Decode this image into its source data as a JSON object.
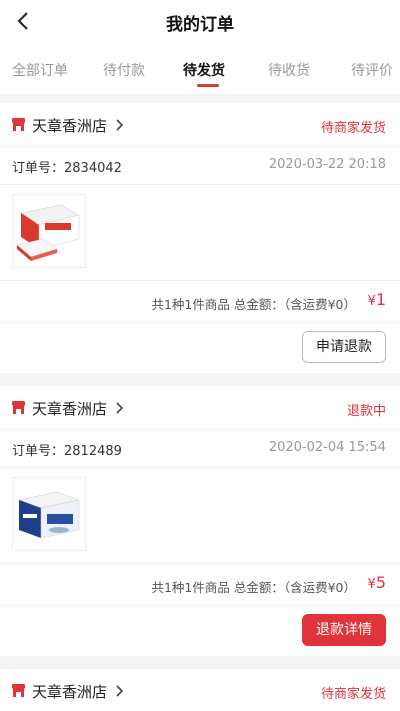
{
  "header": {
    "title": "我的订单",
    "back_icon": "chevron-left-icon"
  },
  "tabs": [
    {
      "label": "全部订单",
      "active": false
    },
    {
      "label": "待付款",
      "active": false
    },
    {
      "label": "待发货",
      "active": true
    },
    {
      "label": "待收货",
      "active": false
    },
    {
      "label": "待评价",
      "active": false
    }
  ],
  "colors": {
    "accent": "#e0333a",
    "muted": "#999999"
  },
  "orders": [
    {
      "store": "天章香洲店",
      "status": "待商家发货",
      "order_no": "订单号：2834042",
      "time": "2020-03-22 20:18",
      "summary": "共1种1件商品 总金额：（含运费¥0）",
      "currency": "¥",
      "amount": "1",
      "action": "申请退款"
    },
    {
      "store": "天章香洲店",
      "status": "退款中",
      "order_no": "订单号：2812489",
      "time": "2020-02-04 15:54",
      "summary": "共1种1件商品 总金额：（含运费¥0）",
      "currency": "¥",
      "amount": "5",
      "action": "退款详情"
    },
    {
      "store": "天章香洲店",
      "status": "待商家发货"
    }
  ]
}
